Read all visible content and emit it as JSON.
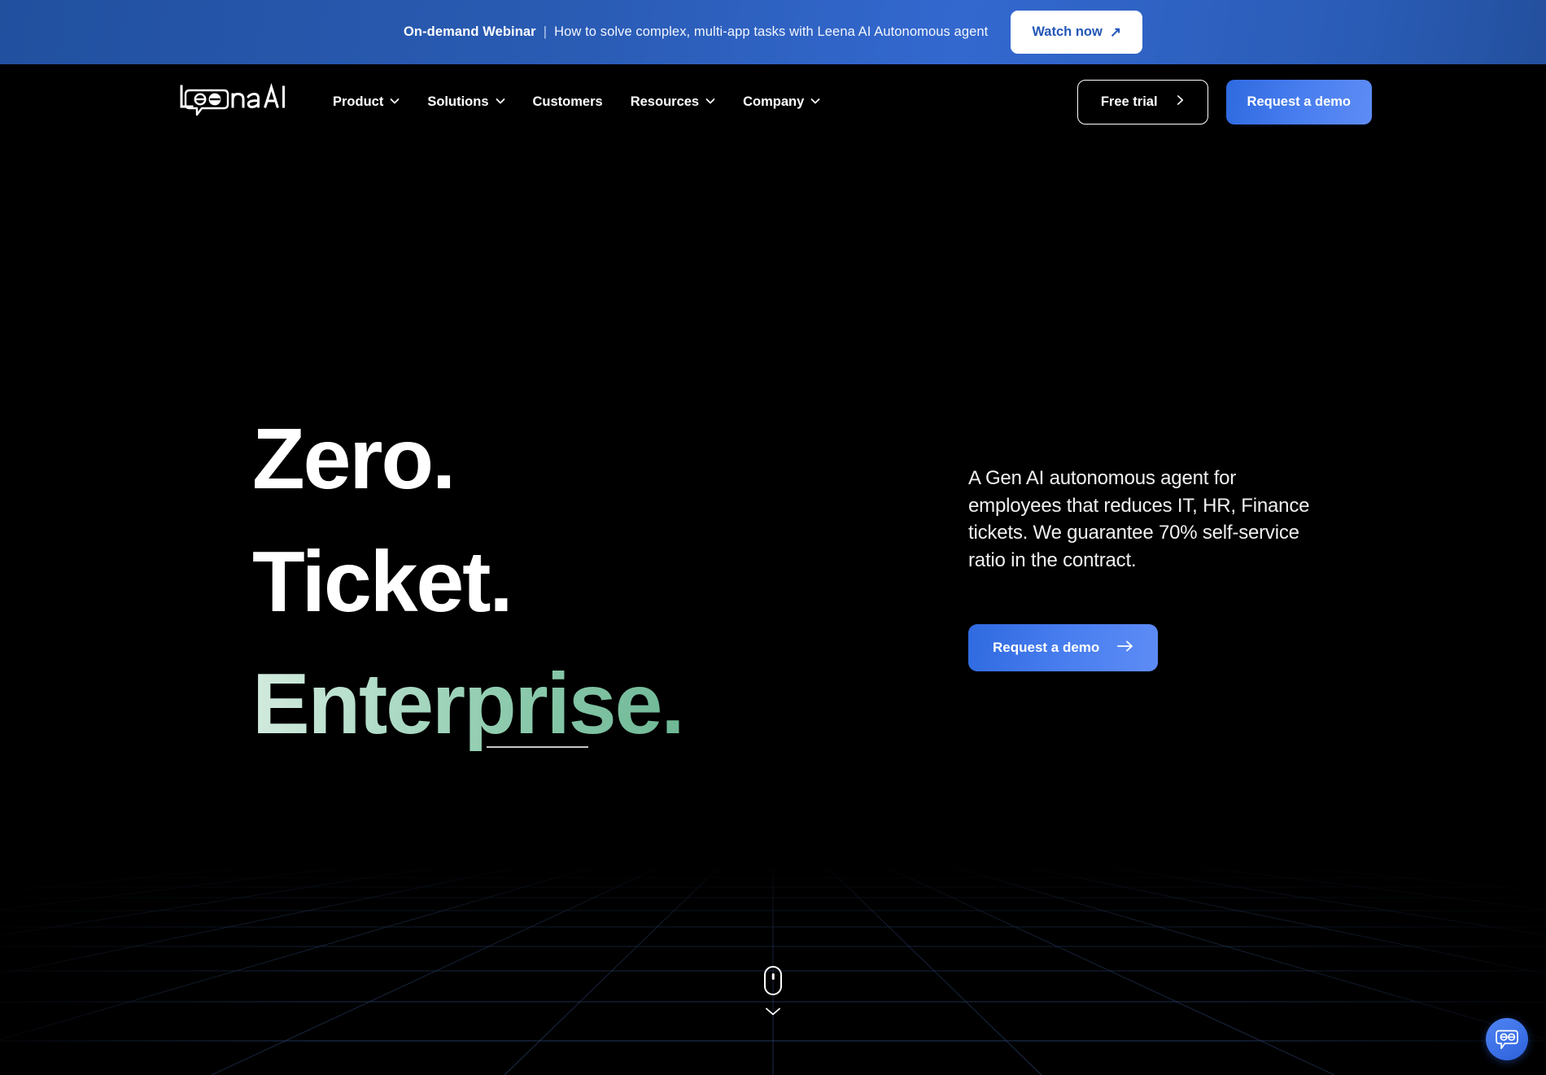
{
  "banner": {
    "strong": "On-demand Webinar",
    "separator": "|",
    "text": "How to solve complex, multi-app tasks with Leena AI Autonomous agent",
    "cta_label": "Watch now",
    "cta_icon": "arrow-up-right-icon",
    "bg_color_start": "#21509f",
    "bg_color_end": "#3368cf",
    "cta_text_color": "#2457b8"
  },
  "nav": {
    "logo_text": "Leena AI",
    "items": [
      {
        "label": "Product",
        "has_chevron": true
      },
      {
        "label": "Solutions",
        "has_chevron": true
      },
      {
        "label": "Customers",
        "has_chevron": false
      },
      {
        "label": "Resources",
        "has_chevron": true
      },
      {
        "label": "Company",
        "has_chevron": true
      }
    ],
    "free_trial_label": "Free trial",
    "free_trial_icon": "chevron-right-icon",
    "request_demo_label": "Request a demo",
    "accent_color": "#4a7ff0"
  },
  "hero": {
    "headline_line1": "Zero.",
    "headline_line2": "Ticket.",
    "headline_line3": "Enterprise.",
    "headline_line3_color": "#8ecbae",
    "description": "A Gen AI autonomous agent for employees that reduces IT, HR, Finance tickets. We guarantee 70% self-service ratio in the contract.",
    "cta_label": "Request a demo",
    "cta_icon": "arrow-right-icon"
  },
  "scroll_indicator": {
    "mouse_icon": "mouse-scroll-icon",
    "chevron_icon": "chevron-down-icon"
  },
  "chat": {
    "icon": "chat-bubble-icon",
    "bg_color": "#3a6fe6"
  }
}
